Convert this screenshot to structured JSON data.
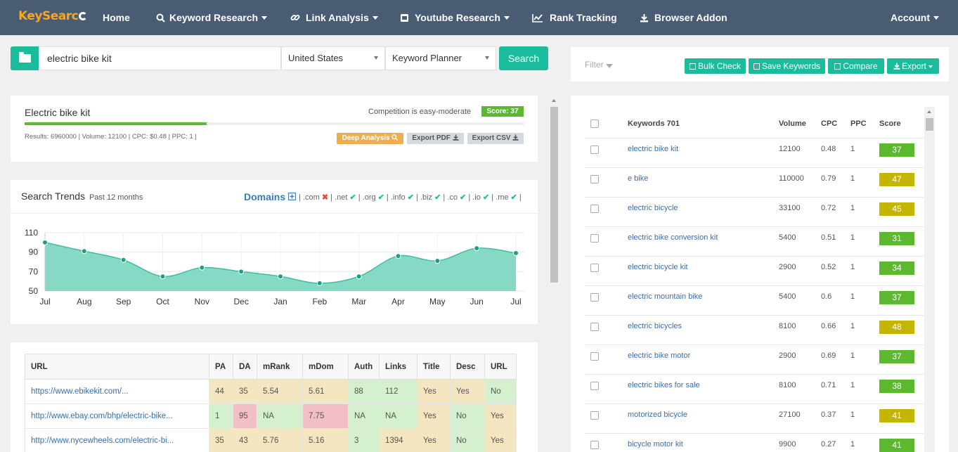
{
  "nav": {
    "logo": {
      "key": "Key",
      "search": "Searc"
    },
    "items": [
      {
        "label": "Home",
        "icon": ""
      },
      {
        "label": "Keyword Research",
        "icon": "search-icon"
      },
      {
        "label": "Link Analysis",
        "icon": "link-icon"
      },
      {
        "label": "Youtube Research",
        "icon": "youtube-icon"
      },
      {
        "label": "Rank Tracking",
        "icon": "line-chart-icon"
      },
      {
        "label": "Browser Addon",
        "icon": "download-icon"
      }
    ],
    "account": "Account"
  },
  "search": {
    "keyword": "electric bike kit",
    "country": "United States",
    "source": "Keyword Planner",
    "button": "Search"
  },
  "summary": {
    "title": "Electric bike kit",
    "competition": "Competition is easy-moderate",
    "score": "Score: 37",
    "score_value": 37,
    "stats": "Results: 6960000 | Volume: 12100 | CPC: $0.48 | PPC: 1 |",
    "deep_analysis": "Deep Analysis",
    "export_pdf": "Export PDF",
    "export_csv": "Export CSV"
  },
  "trends": {
    "title": "Search Trends",
    "subtitle": "Past 12 months",
    "domains_label": "Domains",
    "domains": [
      {
        "tld": ".com",
        "available": false
      },
      {
        "tld": ".net",
        "available": true
      },
      {
        "tld": ".org",
        "available": true
      },
      {
        "tld": ".info",
        "available": true
      },
      {
        "tld": ".biz",
        "available": true
      },
      {
        "tld": ".co",
        "available": true
      },
      {
        "tld": ".io",
        "available": true
      },
      {
        "tld": ".me",
        "available": true
      }
    ],
    "colors": {
      "fill": "#86d9c5",
      "line": "#3dbfa0",
      "dot": "#1aa085"
    }
  },
  "chart_data": {
    "type": "area",
    "x": [
      "Jul",
      "Aug",
      "Sep",
      "Oct",
      "Nov",
      "Dec",
      "Jan",
      "Feb",
      "Mar",
      "Apr",
      "May",
      "Jun",
      "Jul"
    ],
    "y_ticks": [
      110,
      90,
      70,
      50
    ],
    "ylim": [
      50,
      110
    ],
    "series": [
      {
        "values": [
          100,
          91,
          82,
          65,
          74,
          70,
          65,
          58,
          65,
          86,
          81,
          94,
          89
        ]
      }
    ]
  },
  "url_table": {
    "headers": [
      "URL",
      "PA",
      "DA",
      "mRank",
      "mDom",
      "Auth",
      "Links",
      "Title",
      "Desc",
      "URL"
    ],
    "rows": [
      {
        "cells": [
          "https://www.ebikekit.com/...",
          "44",
          "35",
          "5.54",
          "5.61",
          "88",
          "112",
          "Yes",
          "Yes",
          "No"
        ],
        "colors": [
          "",
          "y",
          "y",
          "y",
          "y",
          "g",
          "g",
          "y",
          "y",
          "g"
        ]
      },
      {
        "cells": [
          "http://www.ebay.com/bhp/electric-bike...",
          "1",
          "95",
          "NA",
          "7.75",
          "NA",
          "NA",
          "Yes",
          "No",
          "Yes"
        ],
        "colors": [
          "",
          "g",
          "r",
          "g",
          "r",
          "g",
          "g",
          "y",
          "g",
          "y"
        ]
      },
      {
        "cells": [
          "http://www.nycewheels.com/electric-bi...",
          "35",
          "43",
          "5.76",
          "5.16",
          "3",
          "1394",
          "Yes",
          "No",
          "Yes"
        ],
        "colors": [
          "",
          "y",
          "y",
          "y",
          "y",
          "g",
          "y",
          "y",
          "g",
          "y"
        ]
      }
    ]
  },
  "right": {
    "filter": "Filter",
    "buttons": {
      "bulk_check": "Bulk Check",
      "save_keywords": "Save Keywords",
      "compare": "Compare",
      "export": "Export"
    },
    "headers": {
      "keywords": "Keywords 701",
      "volume": "Volume",
      "cpc": "CPC",
      "ppc": "PPC",
      "score": "Score"
    },
    "score_colors": {
      "green": "#5cb82f",
      "olive": "#c4b600"
    },
    "rows": [
      {
        "keyword": "electric bike kit",
        "volume": "12100",
        "cpc": "0.48",
        "ppc": "1",
        "score": "37",
        "color": "green"
      },
      {
        "keyword": "e bike",
        "volume": "110000",
        "cpc": "0.79",
        "ppc": "1",
        "score": "47",
        "color": "olive"
      },
      {
        "keyword": "electric bicycle",
        "volume": "33100",
        "cpc": "0.72",
        "ppc": "1",
        "score": "45",
        "color": "olive"
      },
      {
        "keyword": "electric bike conversion kit",
        "volume": "5400",
        "cpc": "0.51",
        "ppc": "1",
        "score": "31",
        "color": "green"
      },
      {
        "keyword": "electric bicycle kit",
        "volume": "2900",
        "cpc": "0.52",
        "ppc": "1",
        "score": "34",
        "color": "green"
      },
      {
        "keyword": "electric mountain bike",
        "volume": "5400",
        "cpc": "0.6",
        "ppc": "1",
        "score": "37",
        "color": "green"
      },
      {
        "keyword": "electric bicycles",
        "volume": "8100",
        "cpc": "0.66",
        "ppc": "1",
        "score": "48",
        "color": "olive"
      },
      {
        "keyword": "electric bike motor",
        "volume": "2900",
        "cpc": "0.69",
        "ppc": "1",
        "score": "37",
        "color": "green"
      },
      {
        "keyword": "electric bikes for sale",
        "volume": "8100",
        "cpc": "0.71",
        "ppc": "1",
        "score": "38",
        "color": "green"
      },
      {
        "keyword": "motorized bicycle",
        "volume": "27100",
        "cpc": "0.37",
        "ppc": "1",
        "score": "41",
        "color": "olive"
      },
      {
        "keyword": "bicycle motor kit",
        "volume": "9900",
        "cpc": "0.27",
        "ppc": "1",
        "score": "41",
        "color": "green"
      }
    ]
  }
}
